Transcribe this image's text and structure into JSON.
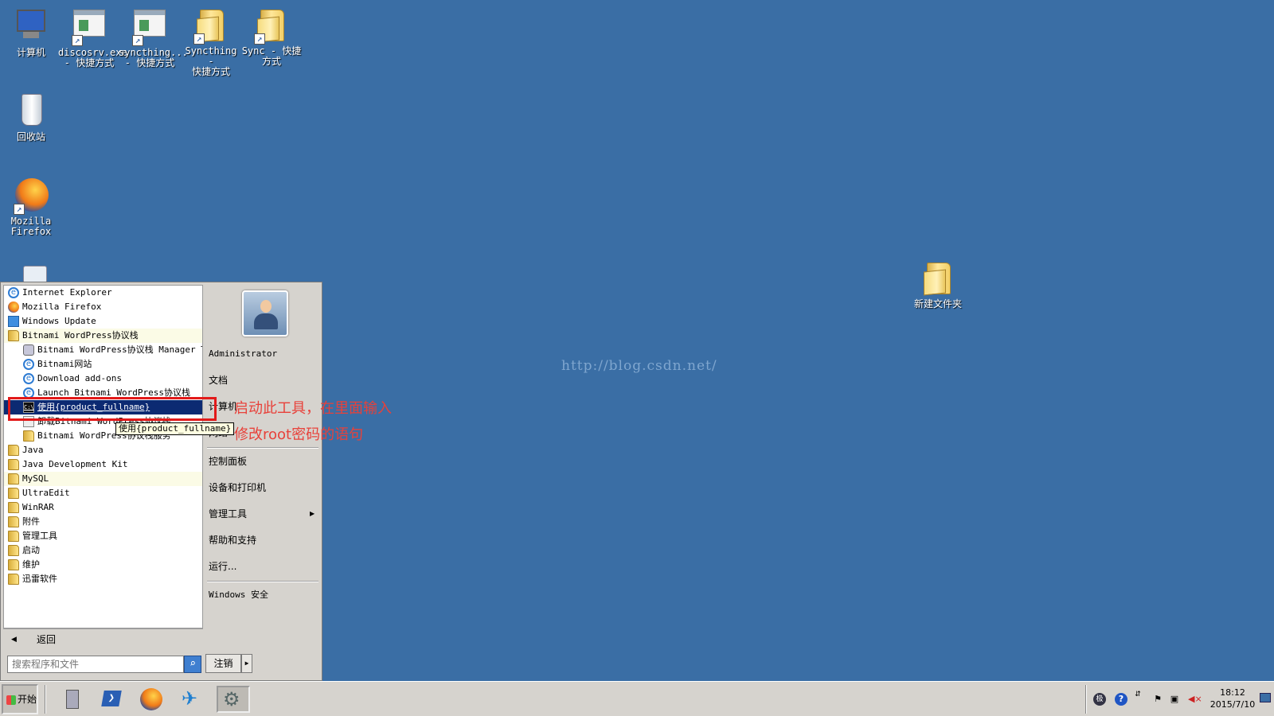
{
  "desktop": {
    "icons": [
      {
        "label": "计算机"
      },
      {
        "label": "discosrv.exe\n- 快捷方式"
      },
      {
        "label": "syncthing...\n- 快捷方式"
      },
      {
        "label": "Syncthing -\n快捷方式"
      },
      {
        "label": "Sync - 快捷\n方式"
      },
      {
        "label": "回收站"
      },
      {
        "label": "Mozilla\nFirefox"
      },
      {
        "label": "新建文件夹"
      }
    ],
    "watermark": "http://blog.csdn.net/"
  },
  "start_menu": {
    "programs": [
      {
        "label": "Internet Explorer",
        "icon": "ie-icon"
      },
      {
        "label": "Mozilla Firefox",
        "icon": "firefox-icon"
      },
      {
        "label": "Windows Update",
        "icon": "windows-update-icon"
      },
      {
        "label": "Bitnami WordPress协议栈",
        "icon": "folder-icon"
      },
      {
        "label": "Bitnami WordPress协议栈 Manager Tool",
        "icon": "tool-icon"
      },
      {
        "label": "Bitnami网站",
        "icon": "ie-icon"
      },
      {
        "label": "Download add-ons",
        "icon": "ie-icon"
      },
      {
        "label": "Launch Bitnami WordPress协议栈",
        "icon": "ie-icon"
      },
      {
        "label": "使用{product_fullname}",
        "icon": "cmd-icon"
      },
      {
        "label": "卸载Bitnami WordPress协议栈",
        "icon": "uninstall-icon"
      },
      {
        "label": "Bitnami WordPress协议栈服务",
        "icon": "folder-icon"
      },
      {
        "label": "Java",
        "icon": "folder-icon"
      },
      {
        "label": "Java Development Kit",
        "icon": "folder-icon"
      },
      {
        "label": "MySQL",
        "icon": "folder-icon"
      },
      {
        "label": "UltraEdit",
        "icon": "folder-icon"
      },
      {
        "label": "WinRAR",
        "icon": "folder-icon"
      },
      {
        "label": "附件",
        "icon": "folder-icon"
      },
      {
        "label": "管理工具",
        "icon": "folder-icon"
      },
      {
        "label": "启动",
        "icon": "folder-icon"
      },
      {
        "label": "维护",
        "icon": "folder-icon"
      },
      {
        "label": "迅雷软件",
        "icon": "folder-icon"
      }
    ],
    "tooltip": "使用{product_fullname}",
    "annotation": "启动此工具，在里面输入修改root密码的语句",
    "back_label": "返回",
    "search_placeholder": "搜索程序和文件",
    "right_pane": {
      "user": "Administrator",
      "items": [
        "文档",
        "计算机",
        "网络",
        "控制面板",
        "设备和打印机",
        "管理工具",
        "帮助和支持",
        "运行...",
        "Windows 安全"
      ]
    },
    "logoff_label": "注销"
  },
  "taskbar": {
    "start_label": "开始",
    "ime_label": "极",
    "time": "18:12",
    "date": "2015/7/10"
  }
}
